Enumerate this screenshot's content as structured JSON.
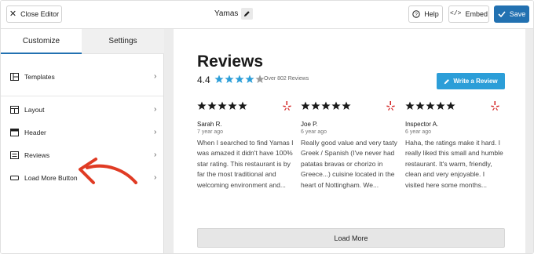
{
  "topbar": {
    "close_label": "Close Editor",
    "title": "Yamas",
    "help_label": "Help",
    "embed_label": "Embed",
    "save_label": "Save"
  },
  "sidebar": {
    "tabs": [
      {
        "label": "Customize",
        "active": true
      },
      {
        "label": "Settings",
        "active": false
      }
    ],
    "items": [
      {
        "label": "Templates",
        "icon": "templates-icon"
      },
      {
        "label": "Layout",
        "icon": "layout-icon"
      },
      {
        "label": "Header",
        "icon": "header-icon"
      },
      {
        "label": "Reviews",
        "icon": "reviews-icon"
      },
      {
        "label": "Load More Button",
        "icon": "button-icon"
      }
    ]
  },
  "main": {
    "heading": "Reviews",
    "rating": "4.4",
    "rating_stars": 4.4,
    "review_count": "Over 802 Reviews",
    "write_review_label": "Write a Review",
    "reviews": [
      {
        "stars": 5,
        "source_icon": "yelp-icon",
        "name": "Sarah R.",
        "when": "7 year ago",
        "text": "When I searched to find Yamas I was amazed it didn't have 100% star rating. This restaurant is by far the most traditional and welcoming environment and..."
      },
      {
        "stars": 5,
        "source_icon": "yelp-icon",
        "name": "Joe P.",
        "when": "6 year ago",
        "text": "Really good value and very tasty Greek / Spanish (I've never had patatas bravas or chorizo in Greece...) cuisine located in the heart of Nottingham. We..."
      },
      {
        "stars": 5,
        "source_icon": "yelp-icon",
        "name": "Inspector A.",
        "when": "6 year ago",
        "text": "Haha, the ratings make it hard. I really liked this small and humble restaurant. It's warm, friendly, clean and very enjoyable. I visited here some months..."
      }
    ],
    "load_more_label": "Load More"
  },
  "colors": {
    "primary": "#2271b1",
    "write_button": "#2c9ed8",
    "star_blue": "#2c9ed8",
    "star_dark": "#1a1a1a",
    "yelp_red": "#d32323",
    "annotation_arrow": "#e03b24"
  }
}
